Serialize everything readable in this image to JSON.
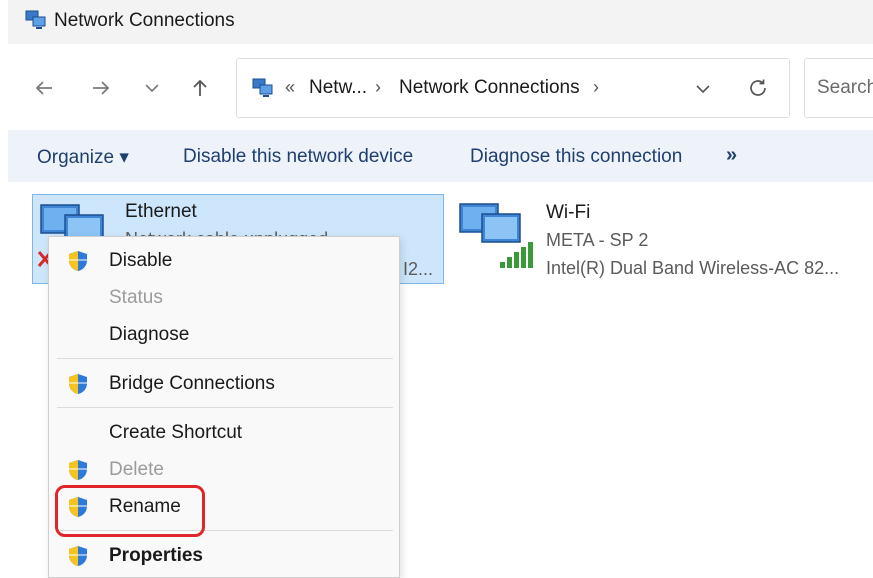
{
  "window": {
    "title": "Network Connections"
  },
  "nav": {
    "back_icon": "arrow-left-icon",
    "forward_icon": "arrow-right-icon",
    "recent_icon": "chevron-down-icon",
    "up_icon": "arrow-up-icon"
  },
  "address": {
    "overflow": "«",
    "crumbs": [
      "Netw...",
      "Network Connections"
    ],
    "separator": "›"
  },
  "search": {
    "placeholder": "Search"
  },
  "commands": {
    "organize": "Organize ▾",
    "disable": "Disable this network device",
    "diagnose": "Diagnose this connection",
    "more": "»"
  },
  "adapters": {
    "ethernet": {
      "name": "Ethernet",
      "status": "Network cable unplugged",
      "device": "I2..."
    },
    "wifi": {
      "name": "Wi-Fi",
      "network": "META - SP 2",
      "device": "Intel(R) Dual Band Wireless-AC 82..."
    }
  },
  "context_menu": {
    "items": [
      {
        "label": "Disable",
        "shield": true,
        "disabled": false,
        "bold": false
      },
      {
        "label": "Status",
        "shield": false,
        "disabled": true,
        "bold": false
      },
      {
        "label": "Diagnose",
        "shield": false,
        "disabled": false,
        "bold": false
      },
      {
        "label": "Bridge Connections",
        "shield": true,
        "disabled": false,
        "bold": false
      },
      {
        "label": "Create Shortcut",
        "shield": false,
        "disabled": false,
        "bold": false
      },
      {
        "label": "Delete",
        "shield": true,
        "disabled": true,
        "bold": false
      },
      {
        "label": "Rename",
        "shield": true,
        "disabled": false,
        "bold": false
      },
      {
        "label": "Properties",
        "shield": true,
        "disabled": false,
        "bold": true
      }
    ]
  },
  "colors": {
    "selection_bg": "#cde6fb",
    "command_bar_bg": "#eef3f9",
    "highlight_border": "#e0252b"
  }
}
